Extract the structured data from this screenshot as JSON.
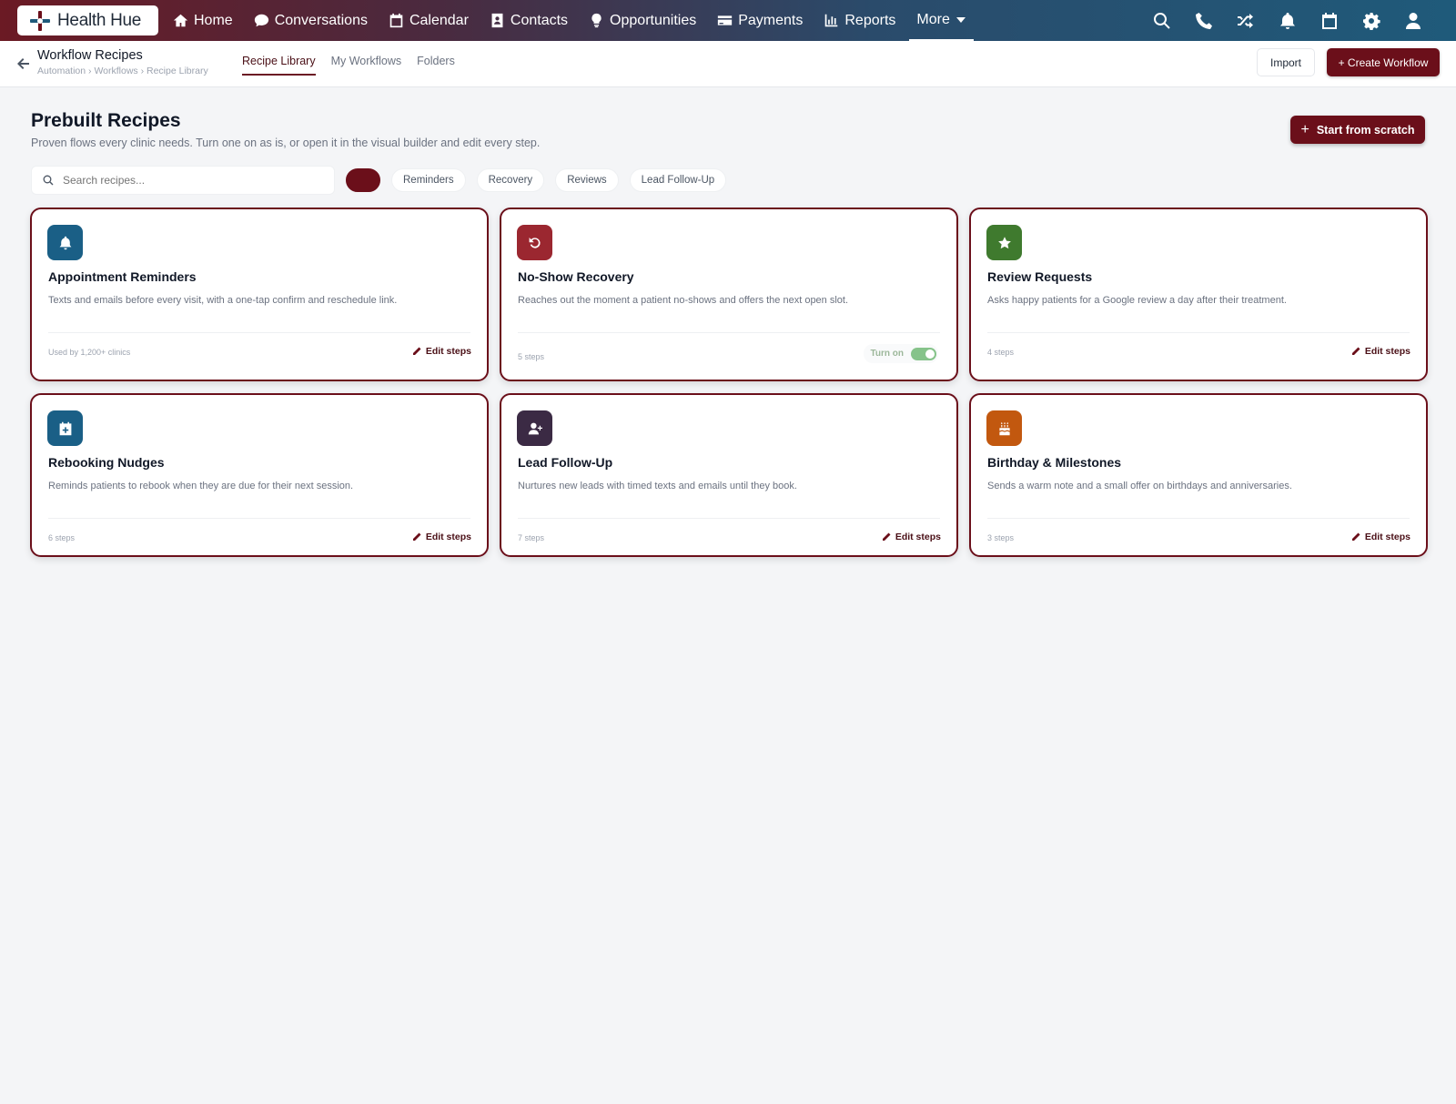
{
  "app": {
    "name": "Health Hue"
  },
  "nav": {
    "items": [
      {
        "label": "Home",
        "icon": "home-icon"
      },
      {
        "label": "Conversations",
        "icon": "chat-icon"
      },
      {
        "label": "Calendar",
        "icon": "calendar-icon"
      },
      {
        "label": "Contacts",
        "icon": "contact-card-icon"
      },
      {
        "label": "Opportunities",
        "icon": "lightbulb-icon"
      },
      {
        "label": "Payments",
        "icon": "credit-card-icon"
      },
      {
        "label": "Reports",
        "icon": "bar-chart-icon"
      }
    ],
    "more_label": "More",
    "right_icons": [
      "search-icon",
      "phone-icon",
      "shuffle-icon",
      "bell-icon",
      "calendar-icon",
      "gear-icon",
      "user-icon"
    ]
  },
  "header": {
    "title": "Workflow Recipes",
    "breadcrumb": "Automation › Workflows › Recipe Library",
    "tabs": [
      {
        "label": "Recipe Library",
        "active": true
      },
      {
        "label": "My Workflows",
        "active": false
      },
      {
        "label": "Folders",
        "active": false
      }
    ],
    "import_label": "Import",
    "create_label": "+ Create Workflow"
  },
  "page": {
    "title": "Prebuilt Recipes",
    "subtitle": "Proven flows every clinic needs. Turn one on as is, or open it in the visual builder and edit every step.",
    "scratch_label": "Start from scratch",
    "search_placeholder": "Search recipes...",
    "filters": [
      "",
      "Reminders",
      "Recovery",
      "Reviews",
      "Lead Follow-Up"
    ],
    "active_filter_index": 0
  },
  "recipes": [
    {
      "title": "Appointment Reminders",
      "description": "Texts and emails before every visit, with a one-tap confirm and reschedule link.",
      "meta": "Used by 1,200+ clinics",
      "action": "Edit steps",
      "icon": "bell-icon",
      "color": "#1a5f86"
    },
    {
      "title": "No-Show Recovery",
      "description": "Reaches out the moment a patient no-shows and offers the next open slot.",
      "meta": "5 steps",
      "action": "Turn on",
      "toggle": true,
      "icon": "undo-icon",
      "color": "#9b2730"
    },
    {
      "title": "Review Requests",
      "description": "Asks happy patients for a Google review a day after their treatment.",
      "meta": "4 steps",
      "action": "Edit steps",
      "icon": "star-icon",
      "color": "#3f7a2e"
    },
    {
      "title": "Rebooking Nudges",
      "description": "Reminds patients to rebook when they are due for their next session.",
      "meta": "6 steps",
      "action": "Edit steps",
      "icon": "calendar-plus-icon",
      "color": "#1a5f86"
    },
    {
      "title": "Lead Follow-Up",
      "description": "Nurtures new leads with timed texts and emails until they book.",
      "meta": "7 steps",
      "action": "Edit steps",
      "icon": "user-plus-icon",
      "color": "#3b2a44"
    },
    {
      "title": "Birthday & Milestones",
      "description": "Sends a warm note and a small offer on birthdays and anniversaries.",
      "meta": "3 steps",
      "action": "Edit steps",
      "icon": "cake-icon",
      "color": "#c2580f"
    }
  ]
}
